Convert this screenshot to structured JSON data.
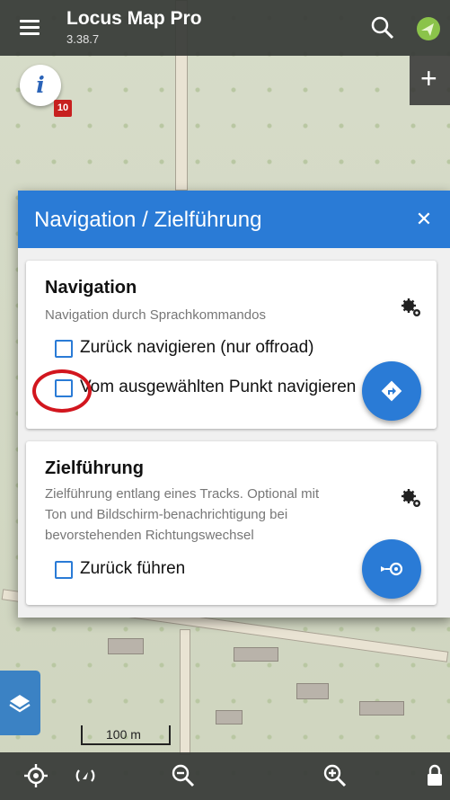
{
  "app": {
    "title": "Locus Map Pro",
    "version": "3.38.7"
  },
  "map": {
    "badge_count": "10",
    "scale_label": "100 m",
    "colors": {
      "accent": "#2a7bd6",
      "badge": "#c7201f",
      "highlight_circle": "#d2161e"
    }
  },
  "topbar": {
    "icons": [
      "menu-icon",
      "search-icon",
      "gps-icon"
    ]
  },
  "dialog": {
    "title": "Navigation / Zielführung",
    "close_icon": "close-icon",
    "navigation": {
      "title": "Navigation",
      "description": "Navigation durch Sprachkommandos",
      "options": [
        {
          "label": "Zurück navigieren (nur offroad)",
          "checked": false
        },
        {
          "label": "Vom ausgewählten Punkt navigieren",
          "checked": false
        }
      ],
      "action_icon": "navigate-icon"
    },
    "guidance": {
      "title": "Zielführung",
      "description": [
        "Zielführung entlang eines Tracks. Optional mit",
        "Ton und Bildschirm-benachrichtigung bei",
        "bevorstehenden Richtungswechsel"
      ],
      "options": [
        {
          "label": "Zurück führen",
          "checked": false
        }
      ],
      "action_icon": "guide-icon"
    }
  },
  "bottombar": {
    "icons": [
      "my-location-icon",
      "compass-icon",
      "zoom-out-icon",
      "zoom-in-icon",
      "lock-icon"
    ]
  }
}
